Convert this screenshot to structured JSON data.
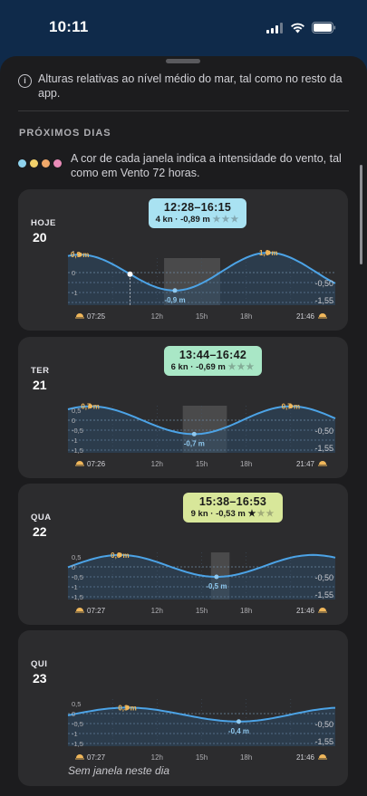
{
  "status": {
    "time": "10:11"
  },
  "info_text": "Alturas relativas ao nível médio do mar, tal como no resto da app.",
  "section_title": "PRÓXIMOS DIAS",
  "legend_text": "A cor de cada janela indica a intensidade do vento, tal como em Vento 72 horas.",
  "legend_colors": [
    "#8fd3ee",
    "#f2d16b",
    "#f0a86a",
    "#e98bb8"
  ],
  "cards": [
    {
      "day_name": "HOJE",
      "day_num": "20",
      "window": {
        "time": "12:28–16:15",
        "wind": "4 kn",
        "height": "· -0,89 m",
        "stars": "★★★",
        "filled_stars": 0,
        "color": "#a9e2f2"
      },
      "sunrise": "07:25",
      "sunset": "21:46",
      "ticks": [
        "12h",
        "15h",
        "18h"
      ],
      "y_left": [
        "1",
        "0",
        "-1"
      ],
      "y_right": [
        "-0,50",
        "-1,55"
      ],
      "labels": [
        "0,9 m",
        "-0,9 m",
        "1,0 m"
      ],
      "now_marker": true,
      "curve": {
        "high1_h": 6.8,
        "high1_v": 0.9,
        "low_h": 13.2,
        "low_v": -0.9,
        "high2_h": 19.5,
        "high2_v": 1.0,
        "win_start": 12.47,
        "win_end": 16.25,
        "now_h": 10.18
      }
    },
    {
      "day_name": "TER",
      "day_num": "21",
      "window": {
        "time": "13:44–16:42",
        "wind": "6 kn",
        "height": "· -0,69 m",
        "stars": "★★★",
        "filled_stars": 0,
        "color": "#a9e7c6"
      },
      "sunrise": "07:26",
      "sunset": "21:47",
      "ticks": [
        "12h",
        "15h",
        "18h"
      ],
      "y_left": [
        "0,5",
        "0",
        "-0,5",
        "-1",
        "-1,5"
      ],
      "y_right": [
        "-0,50",
        "-1,55"
      ],
      "labels": [
        "0,7 m",
        "-0,7 m",
        "0,7 m"
      ],
      "now_marker": false,
      "curve": {
        "high1_h": 7.5,
        "high1_v": 0.7,
        "low_h": 14.5,
        "low_v": -0.7,
        "high2_h": 21.0,
        "high2_v": 0.7,
        "win_start": 13.73,
        "win_end": 16.7
      }
    },
    {
      "day_name": "QUA",
      "day_num": "22",
      "window": {
        "time": "15:38–16:53",
        "wind": "9 kn",
        "height": "· -0,53 m",
        "stars": "★★★",
        "filled_stars": 1,
        "color": "#d8e79a"
      },
      "sunrise": "07:27",
      "sunset": "21:46",
      "ticks": [
        "12h",
        "15h",
        "18h"
      ],
      "y_left": [
        "0,5",
        "0",
        "-0,5",
        "-1",
        "-1,5"
      ],
      "y_right": [
        "-0,50",
        "-1,55"
      ],
      "labels": [
        "0,6 m",
        "-0,5 m"
      ],
      "now_marker": false,
      "curve": {
        "high1_h": 9.5,
        "high1_v": 0.6,
        "low_h": 16.0,
        "low_v": -0.5,
        "high2_h": 22.5,
        "high2_v": 0.6,
        "win_start": 15.63,
        "win_end": 16.88
      }
    },
    {
      "day_name": "QUI",
      "day_num": "23",
      "sunrise": "07:27",
      "sunset": "21:46",
      "ticks": [
        "12h",
        "15h",
        "18h"
      ],
      "y_left": [
        "0,5",
        "0",
        "-0,5",
        "-1",
        "-1,5"
      ],
      "y_right": [
        "-0,50",
        "-1,55"
      ],
      "labels": [
        "0,3 m",
        "-0,4 m"
      ],
      "now_marker": false,
      "no_window_text": "Sem janela neste dia",
      "curve": {
        "high1_h": 10.0,
        "high1_v": 0.3,
        "low_h": 17.5,
        "low_v": -0.4,
        "high2_h": 24.5,
        "high2_v": 0.3
      }
    }
  ]
}
